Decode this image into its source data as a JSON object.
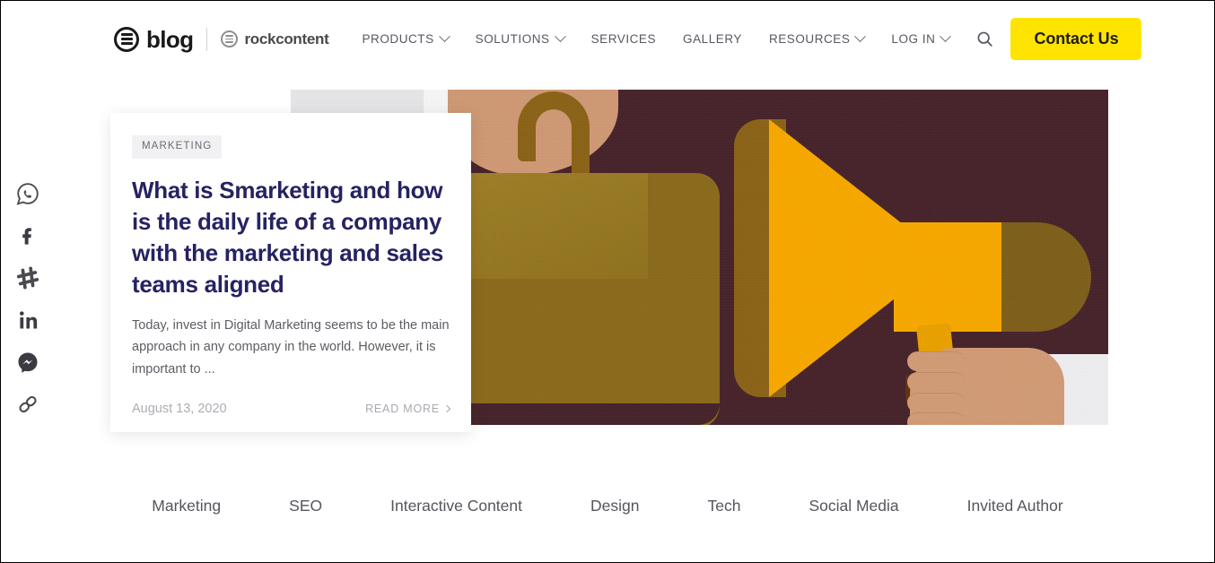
{
  "header": {
    "blog_logo_text": "blog",
    "rockcontent_logo_text": "rockcontent",
    "nav": [
      {
        "label": "PRODUCTS",
        "has_dropdown": true
      },
      {
        "label": "SOLUTIONS",
        "has_dropdown": true
      },
      {
        "label": "SERVICES",
        "has_dropdown": false
      },
      {
        "label": "GALLERY",
        "has_dropdown": false
      },
      {
        "label": "RESOURCES",
        "has_dropdown": true
      },
      {
        "label": "LOG IN",
        "has_dropdown": true
      }
    ],
    "search_icon": "search-icon",
    "contact_button_label": "Contact Us",
    "contact_button_color": "#ffe400"
  },
  "social_rail": [
    {
      "name": "whatsapp-icon",
      "label": "WhatsApp"
    },
    {
      "name": "facebook-icon",
      "label": "Facebook"
    },
    {
      "name": "slack-icon",
      "label": "Slack"
    },
    {
      "name": "linkedin-icon",
      "label": "LinkedIn"
    },
    {
      "name": "messenger-icon",
      "label": "Messenger"
    },
    {
      "name": "link-icon",
      "label": "Copy link"
    }
  ],
  "hero": {
    "background_color": "#47242b",
    "illustration_alt": "Illustration of a briefcase and a hand holding a yellow megaphone",
    "colors": {
      "megaphone_yellow": "#f5a700",
      "megaphone_shadow": "#8a6318",
      "briefcase": "#8a6a1d",
      "skin": "#d09a75",
      "grill_dark": "#62300d"
    }
  },
  "featured_article": {
    "category": "MARKETING",
    "title": "What is Smarketing and how is the daily life of a company with the marketing and sales teams aligned",
    "excerpt": "Today, invest in Digital Marketing seems to be the main approach in any company in the world. However, it is important to ...",
    "date": "August 13, 2020",
    "read_more_label": "READ MORE",
    "title_color": "#262262"
  },
  "categories": [
    {
      "label": "Marketing"
    },
    {
      "label": "SEO"
    },
    {
      "label": "Interactive Content"
    },
    {
      "label": "Design"
    },
    {
      "label": "Tech"
    },
    {
      "label": "Social Media"
    },
    {
      "label": "Invited Author"
    }
  ]
}
